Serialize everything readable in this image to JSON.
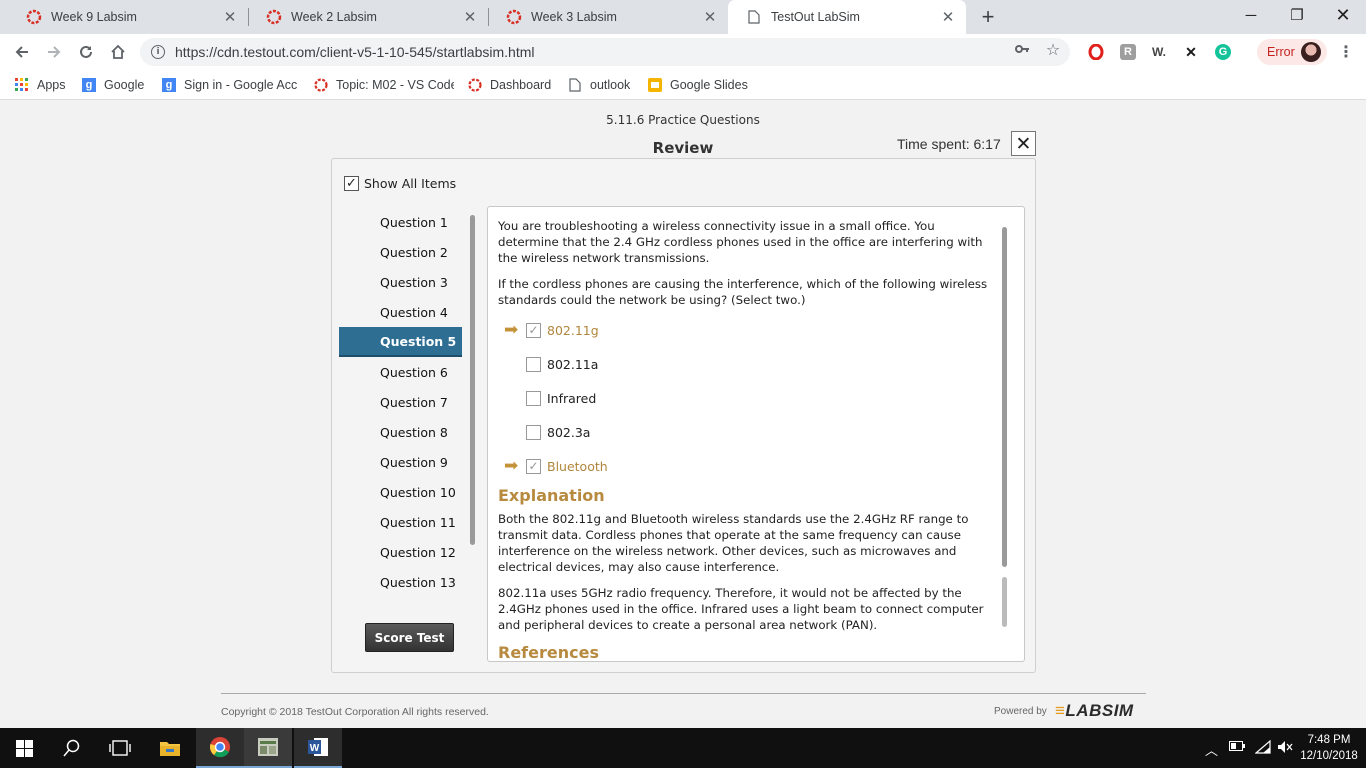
{
  "browser": {
    "tabs": [
      {
        "title": "Week 9 Labsim",
        "active": false
      },
      {
        "title": "Week 2 Labsim",
        "active": false
      },
      {
        "title": "Week 3 Labsim",
        "active": false
      },
      {
        "title": "TestOut LabSim",
        "active": true
      }
    ],
    "url": "https://cdn.testout.com/client-v5-1-10-545/startlabsim.html",
    "profile_label": "Error",
    "bookmarks": [
      "Apps",
      "Google",
      "Sign in - Google Acc",
      "Topic: M02 - VS Code",
      "Dashboard",
      "outlook",
      "Google Slides"
    ]
  },
  "header": {
    "lab_title": "5.11.6 Practice Questions",
    "review_title": "Review",
    "time_spent": "Time spent: 6:17"
  },
  "sidebar": {
    "show_all_label": "Show All Items",
    "show_all_checked": true,
    "questions": [
      "Question 1",
      "Question 2",
      "Question 3",
      "Question 4",
      "Question 5",
      "Question 6",
      "Question 7",
      "Question 8",
      "Question 9",
      "Question 10",
      "Question 11",
      "Question 12",
      "Question 13"
    ],
    "active_index": 4,
    "score_button": "Score Test"
  },
  "question": {
    "stem_1": "You are troubleshooting a wireless connectivity issue in a small office. You determine that the 2.4 GHz cordless phones used in the office are interfering with the wireless network transmissions.",
    "stem_2": "If the cordless phones are causing the interference, which of the following wireless standards could the network be using? (Select two.)",
    "answers": [
      {
        "label": "802.11g",
        "correct": true,
        "checked": true
      },
      {
        "label": "802.11a",
        "correct": false,
        "checked": false
      },
      {
        "label": "Infrared",
        "correct": false,
        "checked": false
      },
      {
        "label": "802.3a",
        "correct": false,
        "checked": false
      },
      {
        "label": "Bluetooth",
        "correct": true,
        "checked": true
      }
    ],
    "explanation_heading": "Explanation",
    "explanation_1": "Both the 802.11g and Bluetooth wireless standards use the 2.4GHz RF range to transmit data. Cordless phones that operate at the same frequency can cause interference on the wireless network. Other devices, such as microwaves and electrical devices, may also cause interference.",
    "explanation_2": "802.11a uses 5GHz radio frequency. Therefore, it would not be affected by the 2.4GHz phones used in the office. Infrared uses a light beam to connect computer and peripheral devices to create a personal area network (PAN).",
    "references_heading": "References"
  },
  "footer": {
    "copyright": "Copyright © 2018  TestOut Corporation All rights reserved.",
    "powered_by": "Powered by",
    "logo_text": "LABSIM"
  },
  "taskbar": {
    "time": "7:48 PM",
    "date": "12/10/2018"
  },
  "colors": {
    "accent": "#2e6e93",
    "correct": "#b0863c",
    "heading": "#b78a3f"
  }
}
